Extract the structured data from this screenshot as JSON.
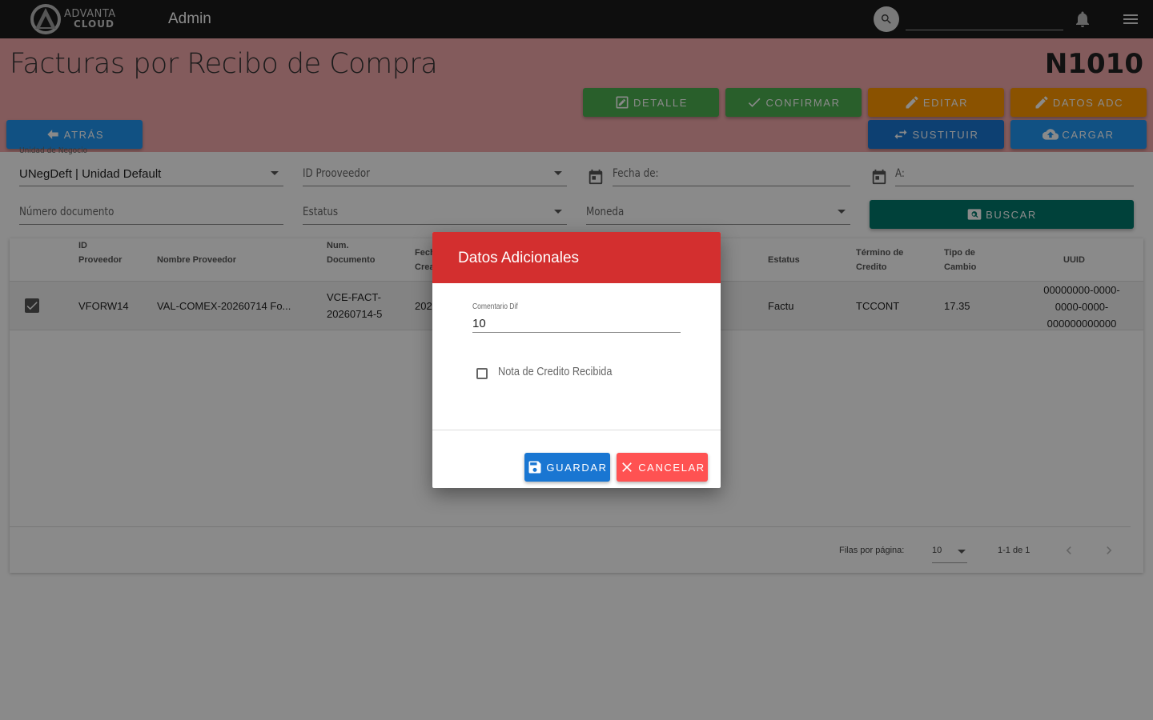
{
  "topbar": {
    "logo_line1": "ADVANTA",
    "logo_line2": "CLOUD",
    "section": "Admin",
    "search_placeholder": ""
  },
  "header": {
    "title": "Facturas por Recibo de Compra",
    "code": "N1010",
    "buttons": {
      "detalle": "DETALLE",
      "confirmar": "CONFIRMAR",
      "editar": "EDITAR",
      "datos_adc": "DATOS ADC",
      "atras": "ATRÁS",
      "sustituir": "SUSTITUIR",
      "cargar": "CARGAR"
    }
  },
  "filters": {
    "unidad_label": "Unidad de Negocio",
    "unidad_value": "UNegDeft | Unidad Default",
    "id_proveedor": "ID Prooveedor",
    "fecha_de": "Fecha de:",
    "fecha_a": "A:",
    "numero_documento": "Número documento",
    "estatus": "Estatus",
    "moneda": "Moneda",
    "buscar": "BUSCAR"
  },
  "table": {
    "headers": {
      "id_proveedor": [
        "ID",
        "Proveedor"
      ],
      "nombre_proveedor": "Nombre Proveedor",
      "num_documento": [
        "Num.",
        "Documento"
      ],
      "fecha": [
        "Fech",
        "Crea"
      ],
      "estatus": "Estatus",
      "termino": [
        "Término de",
        "Credito"
      ],
      "tipo_cambio": [
        "Tipo de",
        "Cambio"
      ],
      "uuid": "UUID"
    },
    "rows": [
      {
        "id": "VFORW14",
        "nombre": "VAL-COMEX-20260714 Fo...",
        "num_doc": [
          "VCE-FACT-",
          "20260714-5"
        ],
        "fecha": "202",
        "estatus": "Factu",
        "termino": "TCCONT",
        "tipo_cambio": "17.35",
        "uuid": [
          "00000000-0000-",
          "0000-0000-",
          "000000000000"
        ]
      }
    ],
    "footer": {
      "rows_per_page_label": "Filas por página:",
      "rows_per_page": "10",
      "range": "1-1 de 1"
    }
  },
  "dialog": {
    "title": "Datos Adicionales",
    "comentario_label": "Comentario Dif",
    "comentario_value": "10",
    "nota_credito_label": "Nota de Credito Recibida",
    "guardar": "GUARDAR",
    "cancelar": "CANCELAR"
  },
  "colors": {
    "topbar": "#1a1a1a",
    "header_band": "#f3a9ab",
    "green": "#4caf50",
    "orange": "#ff9800",
    "blue": "#1976d2",
    "light_blue": "#2196f3",
    "teal": "#00796b",
    "dialog_header": "#d32f2f",
    "cancel": "#ff5252"
  }
}
